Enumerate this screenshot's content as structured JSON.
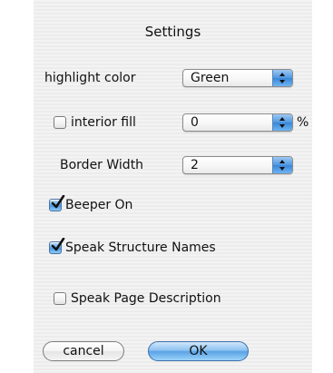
{
  "dialog": {
    "title": "Settings",
    "highlight_color": {
      "label": "highlight color",
      "value": "Green"
    },
    "interior_fill": {
      "label": "interior fill",
      "checked": false,
      "value": "0",
      "unit": "%"
    },
    "border_width": {
      "label": "Border Width",
      "value": "2"
    },
    "beeper_on": {
      "label": "Beeper On",
      "checked": true
    },
    "speak_structure_names": {
      "label": "Speak Structure Names",
      "checked": true
    },
    "speak_page_description": {
      "label": "Speak Page Description",
      "checked": false
    },
    "cancel_label": "cancel",
    "ok_label": "OK"
  },
  "colors": {
    "accent_blue": "#4f97e0",
    "dialog_background": "#f0f0f0"
  },
  "icons": {
    "popup_arrows": "up-down-arrows-icon",
    "checkmark": "checkmark-icon"
  }
}
